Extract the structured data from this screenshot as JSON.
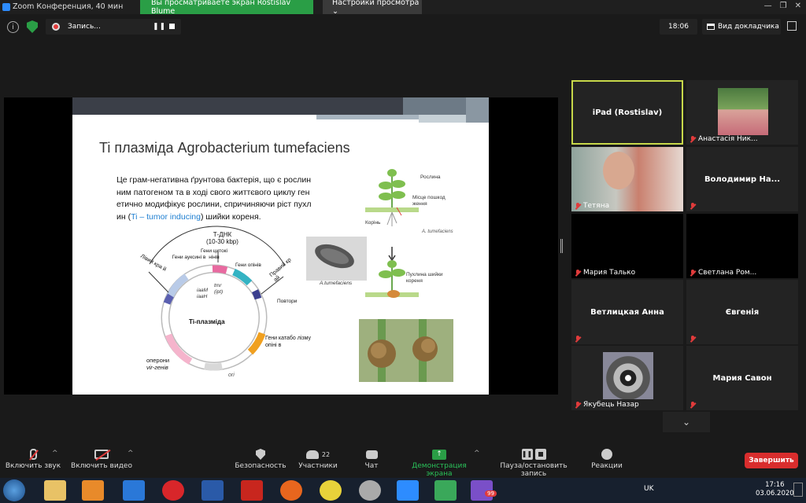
{
  "titlebar": {
    "title": "Zoom Конференция, 40 мин",
    "share_notice": "Вы просматриваете экран Rostislav Blume",
    "view_options": "Настройки просмотра ⌄"
  },
  "topbar": {
    "recording_label": "Запись...",
    "timer": "18:06",
    "view_label": "Вид докладчика"
  },
  "slide": {
    "title": "Ti плазміда Agrobacterium tumefaciens",
    "text_line1": "Це грам-негативна ґрунтова бактерія, що є рослин",
    "text_line2": "ним патогеном та в ході свого життєвого циклу ген",
    "text_line3": "етично модифікує рослини, спричиняючи ріст пухл",
    "text_line4a": "ин (",
    "text_line4b": "Ti – tumor inducing",
    "text_line4c": ") шийки кореня.",
    "plasmid": {
      "center": "Ti-плазміда",
      "tdna": "Т-ДНК",
      "tdna_size": "(10-30 kbp)",
      "left_border": "Лівий кра й",
      "right_border": "Правий кр ай",
      "auxin": "Гени ауксині в",
      "cytokinin": "Гени цитокі нінів",
      "opine": "Гени опінів",
      "repeats": "Повтори",
      "iaaM": "iaaM",
      "iaaH": "iaaH",
      "tmr": "tmr",
      "ipt": "(ipt)",
      "catabolism": "Гени катабо лізму опіні в",
      "vir_operons": "оперони",
      "vir_genes": "vir-генів",
      "ori": "ori"
    },
    "bacterium_label": "A.tumefaciens",
    "plant": {
      "plant": "Рослина",
      "wound": "Місце пошкод ження",
      "root": "Корінь",
      "bact": "A. tumefaciens",
      "tumor": "Пухлина шийки кореня"
    }
  },
  "participants": [
    {
      "name": "iPad (Rostislav)",
      "muted": false,
      "active": true
    },
    {
      "name": "Анастасія Ник...",
      "muted": true,
      "photo": true
    },
    {
      "name": "Тетяна",
      "muted": true,
      "photo": true
    },
    {
      "name": "Володимир На...",
      "muted": true
    },
    {
      "name": "Мария Талько",
      "muted": true
    },
    {
      "name": "Светлана Ром...",
      "muted": true
    },
    {
      "name": "Ветлицкая Анна",
      "muted": true
    },
    {
      "name": "Євгенія",
      "muted": true
    },
    {
      "name": "Якубець Назар",
      "muted": true,
      "photo": true
    },
    {
      "name": "Мария Савон",
      "muted": true
    }
  ],
  "toolbar": {
    "unmute": "Включить звук",
    "start_video": "Включить видео",
    "security": "Безопасность",
    "participants": "Участники",
    "participants_count": "22",
    "chat": "Чат",
    "share": "Демонстрация экрана",
    "pause_record": "Пауза/остановить запись",
    "reactions": "Реакции",
    "end": "Завершить"
  },
  "taskbar": {
    "lang": "UK",
    "time": "17:16",
    "date": "03.06.2020",
    "viber_badge": "99"
  },
  "colors": {
    "zoom_green": "#2a9e46",
    "end_red": "#d92d2d",
    "active_border": "#c7d84a",
    "link_blue": "#1f7fd1"
  }
}
